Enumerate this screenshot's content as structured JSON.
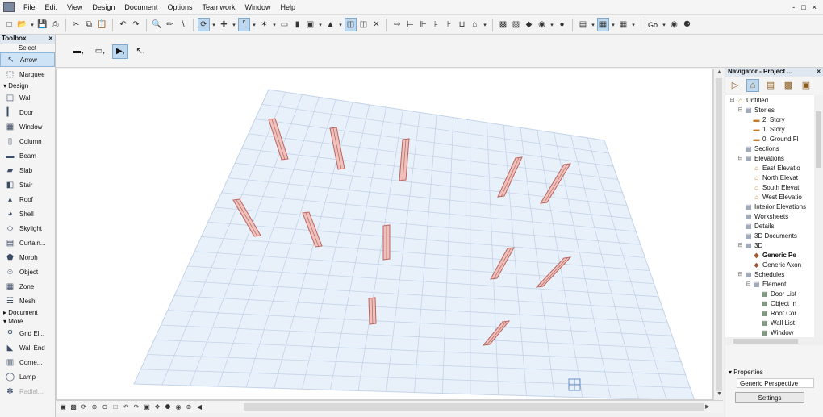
{
  "menubar": {
    "items": [
      "File",
      "Edit",
      "View",
      "Design",
      "Document",
      "Options",
      "Teamwork",
      "Window",
      "Help"
    ],
    "controls": [
      "-",
      "□",
      "×"
    ]
  },
  "toolbar": {
    "go_label": "Go"
  },
  "toolbox": {
    "title": "Toolbox",
    "close": "×",
    "select_header": "Select",
    "arrow_label": "Arrow",
    "marquee_label": "Marquee",
    "design_header": "Design",
    "design_tools": [
      "Wall",
      "Door",
      "Window",
      "Column",
      "Beam",
      "Slab",
      "Stair",
      "Roof",
      "Shell",
      "Skylight",
      "Curtain...",
      "Morph",
      "Object",
      "Zone",
      "Mesh"
    ],
    "document_header": "Document",
    "more_header": "More",
    "more_tools": [
      "Grid El...",
      "Wall End",
      "Corne...",
      "Lamp",
      "Radial..."
    ]
  },
  "navigator": {
    "title": "Navigator - Project ...",
    "close": "×",
    "tree": [
      {
        "label": "Untitled",
        "level": 0,
        "exp": "⊟",
        "icon": "house"
      },
      {
        "label": "Stories",
        "level": 1,
        "exp": "⊟",
        "icon": "list"
      },
      {
        "label": "2. Story",
        "level": 2,
        "exp": "",
        "icon": "story"
      },
      {
        "label": "1. Story",
        "level": 2,
        "exp": "",
        "icon": "story"
      },
      {
        "label": "0. Ground Fl",
        "level": 2,
        "exp": "",
        "icon": "story"
      },
      {
        "label": "Sections",
        "level": 1,
        "exp": "",
        "icon": "list"
      },
      {
        "label": "Elevations",
        "level": 1,
        "exp": "⊟",
        "icon": "list"
      },
      {
        "label": "East Elevatio",
        "level": 2,
        "exp": "",
        "icon": "elev"
      },
      {
        "label": "North Elevat",
        "level": 2,
        "exp": "",
        "icon": "elev"
      },
      {
        "label": "South Elevat",
        "level": 2,
        "exp": "",
        "icon": "elev"
      },
      {
        "label": "West Elevatio",
        "level": 2,
        "exp": "",
        "icon": "elev"
      },
      {
        "label": "Interior Elevations",
        "level": 1,
        "exp": "",
        "icon": "list"
      },
      {
        "label": "Worksheets",
        "level": 1,
        "exp": "",
        "icon": "list"
      },
      {
        "label": "Details",
        "level": 1,
        "exp": "",
        "icon": "list"
      },
      {
        "label": "3D Documents",
        "level": 1,
        "exp": "",
        "icon": "list"
      },
      {
        "label": "3D",
        "level": 1,
        "exp": "⊟",
        "icon": "list"
      },
      {
        "label": "Generic Pe",
        "level": 2,
        "exp": "",
        "icon": "persp",
        "selected": true
      },
      {
        "label": "Generic Axon",
        "level": 2,
        "exp": "",
        "icon": "axon"
      },
      {
        "label": "Schedules",
        "level": 1,
        "exp": "⊟",
        "icon": "list"
      },
      {
        "label": "Element",
        "level": 2,
        "exp": "⊟",
        "icon": "list"
      },
      {
        "label": "Door List",
        "level": 3,
        "exp": "",
        "icon": "sched"
      },
      {
        "label": "Object In",
        "level": 3,
        "exp": "",
        "icon": "sched"
      },
      {
        "label": "Roof Cor",
        "level": 3,
        "exp": "",
        "icon": "sched"
      },
      {
        "label": "Wall List",
        "level": 3,
        "exp": "",
        "icon": "sched"
      },
      {
        "label": "Window",
        "level": 3,
        "exp": "",
        "icon": "sched"
      }
    ],
    "properties_header": "Properties",
    "properties_value": "Generic Perspective",
    "settings_label": "Settings"
  },
  "colors": {
    "grid_fill": "#e8f0fa",
    "grid_line": "#c4d3e8",
    "column_fill": "#efc1bd",
    "column_stroke": "#b9655f"
  }
}
